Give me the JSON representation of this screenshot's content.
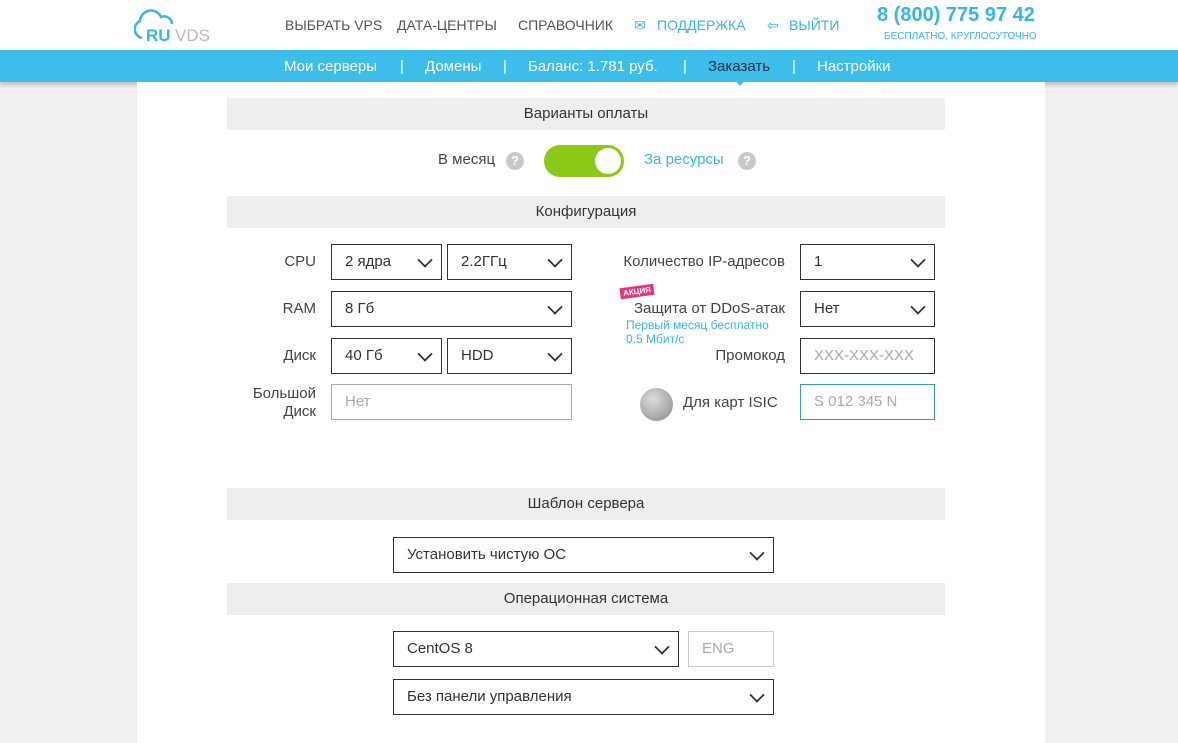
{
  "header": {
    "logo": "RUVDS",
    "nav": [
      "ВЫБРАТЬ VPS",
      "ДАТА-ЦЕНТРЫ",
      "СПРАВОЧНИК",
      "ПОДДЕРЖКА",
      "ВЫЙТИ"
    ],
    "phone": "8 (800) 775 97 42",
    "phone_sub": "БЕСПЛАТНО, КРУГЛОСУТОЧНО"
  },
  "menu": {
    "items": [
      "Мои серверы",
      "Домены",
      "Баланс: 1.781 руб.",
      "Заказать",
      "Настройки"
    ],
    "active": "Заказать"
  },
  "colors": {
    "accent": "#3dbde9",
    "toggle": "#8cc919"
  },
  "payment": {
    "title": "Варианты оплаты",
    "monthly": "В месяц",
    "resources": "За ресурсы",
    "help": "?",
    "toggle_on": true
  },
  "config": {
    "title": "Конфигурация",
    "cpu_label": "CPU",
    "cpu_cores": "2 ядра",
    "cpu_freq": "2.2ГГц",
    "ram_label": "RAM",
    "ram": "8 Гб",
    "disk_label": "Диск",
    "disk_size": "40 Гб",
    "disk_type": "HDD",
    "big_disk_label_1": "Большой",
    "big_disk_label_2": "Диск",
    "big_disk_placeholder": "Нет",
    "ip_label": "Количество IP-адресов",
    "ip": "1",
    "promo_badge": "АКЦИЯ",
    "ddos_label": "Защита от DDoS-атак",
    "ddos": "Нет",
    "ddos_note_1": "Первый месяц бесплатно",
    "ddos_note_2": "0.5 Мбит/с",
    "promo_label": "Промокод",
    "promo_placeholder": "XXX-XXX-XXX",
    "isic_logo": "isic",
    "isic_label": "Для карт ISIC",
    "isic_placeholder": "S 012 345 N"
  },
  "template": {
    "title": "Шаблон сервера",
    "value": "Установить чистую ОС"
  },
  "os": {
    "title": "Операционная система",
    "value": "CentOS 8",
    "lang_placeholder": "ENG",
    "panel": "Без панели управления"
  }
}
